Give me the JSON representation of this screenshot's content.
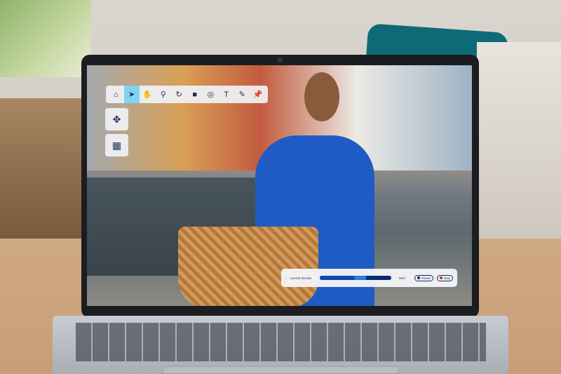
{
  "toolbar": {
    "tools": [
      {
        "name": "home",
        "glyph": "⌂"
      },
      {
        "name": "pointer",
        "glyph": "➤"
      },
      {
        "name": "hand",
        "glyph": "✋"
      },
      {
        "name": "zoom",
        "glyph": "⚲"
      },
      {
        "name": "rotate",
        "glyph": "↻"
      },
      {
        "name": "camera",
        "glyph": "■"
      },
      {
        "name": "focus",
        "glyph": "◎"
      },
      {
        "name": "text",
        "glyph": "T"
      },
      {
        "name": "pen",
        "glyph": "✎"
      },
      {
        "name": "pin",
        "glyph": "📌"
      }
    ],
    "active": "pointer"
  },
  "side": {
    "move": "✥",
    "media": "▦"
  },
  "render": {
    "label": "Current Render",
    "progress_percent": 65,
    "progress_text": "65%",
    "pause": "Pause",
    "stop": "Stop"
  }
}
